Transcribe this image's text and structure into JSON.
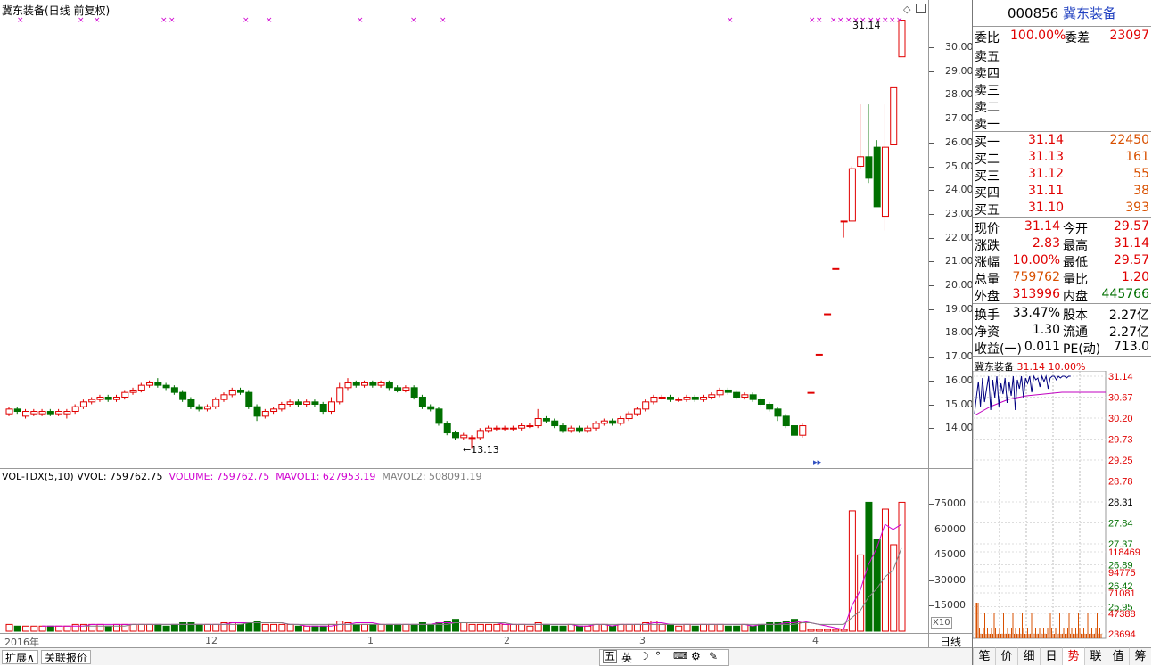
{
  "stock": {
    "code": "000856",
    "name": "冀东装备"
  },
  "main_chart": {
    "title": "冀东装备(日线 前复权)",
    "high_marker": "31.14",
    "low_marker": "←13.13",
    "ticks": [
      "30.00",
      "29.00",
      "28.00",
      "27.00",
      "26.00",
      "25.00",
      "24.00",
      "23.00",
      "22.00",
      "21.00",
      "20.00",
      "19.00",
      "18.00",
      "17.00",
      "16.00",
      "15.00",
      "14.00"
    ],
    "icons": [
      "diamond-icon",
      "square-icon"
    ]
  },
  "volume": {
    "indicator": "VOL-TDX(5,10)",
    "vvol_label": "VVOL: 759762.75",
    "volume_label": "VOLUME: 759762.75",
    "mavol1_label": "MAVOL1: 627953.19",
    "mavol2_label": "MAVOL2: 508091.19",
    "ticks": [
      "75000",
      "60000",
      "45000",
      "30000",
      "15000"
    ],
    "unit": "X10"
  },
  "date_axis": {
    "labels": [
      "2016年",
      "12",
      "1",
      "2",
      "3",
      "4"
    ],
    "period": "日线"
  },
  "bottom_bar": {
    "expand": "扩展∧",
    "related": "关联报价",
    "ime": [
      "五",
      "英"
    ]
  },
  "quote": {
    "weibi_label": "委比",
    "weibi": "100.00%",
    "weicha_label": "委差",
    "weicha": "23097",
    "sell": [
      {
        "label": "卖五"
      },
      {
        "label": "卖四"
      },
      {
        "label": "卖三"
      },
      {
        "label": "卖二"
      },
      {
        "label": "卖一"
      }
    ],
    "buy": [
      {
        "label": "买一",
        "price": "31.14",
        "vol": "22450"
      },
      {
        "label": "买二",
        "price": "31.13",
        "vol": "161"
      },
      {
        "label": "买三",
        "price": "31.12",
        "vol": "55"
      },
      {
        "label": "买四",
        "price": "31.11",
        "vol": "38"
      },
      {
        "label": "买五",
        "price": "31.10",
        "vol": "393"
      }
    ],
    "stats1": [
      {
        "l1": "现价",
        "v1": "31.14",
        "l2": "今开",
        "v2": "29.57"
      },
      {
        "l1": "涨跌",
        "v1": "2.83",
        "l2": "最高",
        "v2": "31.14"
      },
      {
        "l1": "涨幅",
        "v1": "10.00%",
        "l2": "最低",
        "v2": "29.57"
      },
      {
        "l1": "总量",
        "v1": "759762",
        "l2": "量比",
        "v2": "1.20"
      },
      {
        "l1": "外盘",
        "v1": "313996",
        "l2": "内盘",
        "v2": "445766"
      }
    ],
    "stats2": [
      {
        "l1": "换手",
        "v1": "33.47%",
        "l2": "股本",
        "v2": "2.27亿"
      },
      {
        "l1": "净资",
        "v1": "1.30",
        "l2": "流通",
        "v2": "2.27亿"
      },
      {
        "l1": "收益(一)",
        "v1": "0.011",
        "l2": "PE(动)",
        "v2": "713.0"
      }
    ]
  },
  "mini": {
    "name": "冀东装备",
    "price": "31.14",
    "pct": "10.00%",
    "price_ticks": [
      "31.14",
      "30.67",
      "30.20",
      "29.73",
      "29.25",
      "28.78",
      "28.31",
      "27.84",
      "27.37",
      "26.89",
      "26.42",
      "25.95"
    ],
    "vol_ticks": [
      "118469",
      "94775",
      "71081",
      "47388",
      "23694"
    ]
  },
  "tabs": [
    "笔",
    "价",
    "细",
    "日",
    "势",
    "联",
    "值",
    "筹"
  ],
  "colors": {
    "up": "#e00000",
    "down": "#007000",
    "ma1": "#d000d0",
    "ma2": "#808080",
    "marker": "#d000d0"
  },
  "chart_data": {
    "type": "candlestick",
    "ylim": [
      13.0,
      31.5
    ],
    "candles": [
      [
        14.6,
        14.8,
        14.9,
        14.5
      ],
      [
        14.8,
        14.7,
        14.9,
        14.6
      ],
      [
        14.5,
        14.7,
        14.8,
        14.4
      ],
      [
        14.6,
        14.7,
        14.8,
        14.5
      ],
      [
        14.6,
        14.7,
        14.8,
        14.5
      ],
      [
        14.7,
        14.6,
        14.8,
        14.5
      ],
      [
        14.6,
        14.7,
        14.8,
        14.5
      ],
      [
        14.6,
        14.7,
        14.8,
        14.4
      ],
      [
        14.7,
        14.9,
        15.0,
        14.6
      ],
      [
        14.9,
        15.1,
        15.2,
        14.8
      ],
      [
        15.1,
        15.2,
        15.3,
        15.0
      ],
      [
        15.2,
        15.3,
        15.4,
        15.1
      ],
      [
        15.3,
        15.2,
        15.4,
        15.1
      ],
      [
        15.2,
        15.3,
        15.4,
        15.1
      ],
      [
        15.3,
        15.5,
        15.6,
        15.2
      ],
      [
        15.5,
        15.6,
        15.7,
        15.4
      ],
      [
        15.6,
        15.8,
        15.9,
        15.5
      ],
      [
        15.8,
        15.9,
        16.0,
        15.7
      ],
      [
        15.9,
        15.8,
        16.1,
        15.7
      ],
      [
        15.8,
        15.7,
        15.9,
        15.6
      ],
      [
        15.7,
        15.5,
        15.8,
        15.4
      ],
      [
        15.5,
        15.2,
        15.6,
        15.1
      ],
      [
        15.2,
        14.9,
        15.3,
        14.8
      ],
      [
        14.9,
        14.8,
        15.0,
        14.7
      ],
      [
        14.8,
        14.9,
        15.0,
        14.7
      ],
      [
        14.9,
        15.2,
        15.3,
        14.8
      ],
      [
        15.2,
        15.4,
        15.5,
        15.1
      ],
      [
        15.4,
        15.6,
        15.7,
        15.3
      ],
      [
        15.6,
        15.5,
        15.7,
        15.4
      ],
      [
        15.5,
        14.9,
        15.6,
        14.8
      ],
      [
        14.9,
        14.5,
        15.0,
        14.3
      ],
      [
        14.5,
        14.7,
        14.8,
        14.4
      ],
      [
        14.7,
        14.8,
        14.9,
        14.6
      ],
      [
        14.8,
        15.0,
        15.1,
        14.7
      ],
      [
        15.0,
        15.1,
        15.2,
        14.9
      ],
      [
        15.1,
        15.0,
        15.2,
        14.9
      ],
      [
        15.0,
        15.1,
        15.2,
        14.9
      ],
      [
        15.1,
        15.0,
        15.2,
        14.9
      ],
      [
        15.0,
        14.7,
        15.1,
        14.6
      ],
      [
        14.7,
        15.1,
        15.3,
        14.6
      ],
      [
        15.1,
        15.7,
        15.9,
        15.0
      ],
      [
        15.7,
        15.9,
        16.1,
        15.6
      ],
      [
        15.9,
        15.8,
        16.0,
        15.7
      ],
      [
        15.8,
        15.9,
        16.0,
        15.7
      ],
      [
        15.9,
        15.8,
        16.0,
        15.7
      ],
      [
        15.8,
        15.9,
        16.0,
        15.7
      ],
      [
        15.9,
        15.7,
        16.0,
        15.6
      ],
      [
        15.7,
        15.6,
        15.8,
        15.5
      ],
      [
        15.6,
        15.7,
        15.8,
        15.5
      ],
      [
        15.7,
        15.3,
        15.8,
        15.2
      ],
      [
        15.3,
        14.9,
        15.4,
        14.8
      ],
      [
        14.9,
        14.8,
        15.0,
        14.7
      ],
      [
        14.8,
        14.2,
        14.9,
        14.1
      ],
      [
        14.2,
        13.8,
        14.3,
        13.7
      ],
      [
        13.8,
        13.6,
        13.9,
        13.5
      ],
      [
        13.6,
        13.7,
        13.8,
        13.5
      ],
      [
        13.6,
        13.6,
        13.7,
        13.13
      ],
      [
        13.6,
        13.9,
        14.0,
        13.5
      ],
      [
        13.9,
        14.0,
        14.1,
        13.8
      ],
      [
        14.0,
        14.0,
        14.1,
        13.9
      ],
      [
        14.0,
        14.0,
        14.1,
        13.9
      ],
      [
        14.0,
        14.0,
        14.1,
        13.9
      ],
      [
        14.0,
        14.1,
        14.2,
        13.9
      ],
      [
        14.1,
        14.1,
        14.2,
        14.0
      ],
      [
        14.1,
        14.4,
        14.8,
        14.0
      ],
      [
        14.4,
        14.3,
        14.5,
        14.2
      ],
      [
        14.3,
        14.1,
        14.4,
        14.0
      ],
      [
        14.1,
        13.9,
        14.2,
        13.8
      ],
      [
        13.9,
        14.0,
        14.1,
        13.8
      ],
      [
        14.0,
        13.9,
        14.1,
        13.8
      ],
      [
        13.9,
        14.0,
        14.1,
        13.8
      ],
      [
        14.0,
        14.2,
        14.3,
        13.9
      ],
      [
        14.2,
        14.3,
        14.4,
        14.1
      ],
      [
        14.3,
        14.2,
        14.4,
        14.1
      ],
      [
        14.2,
        14.4,
        14.5,
        14.1
      ],
      [
        14.4,
        14.6,
        14.7,
        14.3
      ],
      [
        14.6,
        14.8,
        14.9,
        14.5
      ],
      [
        14.8,
        15.1,
        15.2,
        14.7
      ],
      [
        15.1,
        15.3,
        15.4,
        15.0
      ],
      [
        15.3,
        15.3,
        15.4,
        15.2
      ],
      [
        15.3,
        15.2,
        15.4,
        15.1
      ],
      [
        15.2,
        15.2,
        15.3,
        15.1
      ],
      [
        15.2,
        15.3,
        15.4,
        15.1
      ],
      [
        15.3,
        15.2,
        15.4,
        15.1
      ],
      [
        15.2,
        15.3,
        15.4,
        15.1
      ],
      [
        15.3,
        15.4,
        15.5,
        15.2
      ],
      [
        15.4,
        15.6,
        15.7,
        15.3
      ],
      [
        15.6,
        15.5,
        15.7,
        15.4
      ],
      [
        15.5,
        15.3,
        15.6,
        15.2
      ],
      [
        15.3,
        15.4,
        15.5,
        15.2
      ],
      [
        15.4,
        15.2,
        15.5,
        15.1
      ],
      [
        15.2,
        15.0,
        15.3,
        14.9
      ],
      [
        15.0,
        14.8,
        15.1,
        14.7
      ],
      [
        14.8,
        14.5,
        14.9,
        14.3
      ],
      [
        14.5,
        14.1,
        14.6,
        14.0
      ],
      [
        14.1,
        13.7,
        14.2,
        13.6
      ],
      [
        13.7,
        14.1,
        14.2,
        13.6
      ],
      [
        15.5,
        15.5,
        15.5,
        15.5
      ],
      [
        17.1,
        17.1,
        17.1,
        17.1
      ],
      [
        18.8,
        18.8,
        18.8,
        18.8
      ],
      [
        20.7,
        20.7,
        20.7,
        20.7
      ],
      [
        22.7,
        22.7,
        22.7,
        22.0
      ],
      [
        22.7,
        24.9,
        25.0,
        22.7
      ],
      [
        25.0,
        25.4,
        27.6,
        24.9
      ],
      [
        25.4,
        24.5,
        27.6,
        24.3
      ],
      [
        25.8,
        23.3,
        26.1,
        23.3
      ],
      [
        22.9,
        25.8,
        27.6,
        22.3
      ],
      [
        25.9,
        28.3,
        28.3,
        25.9
      ],
      [
        29.6,
        31.14,
        31.14,
        29.6
      ]
    ],
    "volume": [
      4,
      3,
      3,
      3,
      3,
      3,
      3,
      3,
      4,
      4,
      4,
      4,
      3,
      4,
      4,
      4,
      4,
      4,
      4,
      3,
      4,
      5,
      5,
      4,
      4,
      4,
      5,
      5,
      4,
      5,
      6,
      4,
      4,
      4,
      4,
      3,
      3,
      3,
      3,
      4,
      6,
      5,
      4,
      4,
      4,
      4,
      4,
      4,
      4,
      4,
      5,
      4,
      5,
      6,
      7,
      5,
      4,
      4,
      4,
      4,
      4,
      4,
      4,
      3,
      5,
      4,
      3,
      3,
      4,
      3,
      3,
      4,
      4,
      3,
      4,
      4,
      4,
      5,
      6,
      4,
      4,
      3,
      4,
      3,
      4,
      4,
      4,
      3,
      3,
      4,
      3,
      4,
      5,
      5,
      6,
      7,
      5,
      1,
      1,
      1,
      1,
      1,
      71,
      45,
      76,
      54,
      72,
      51,
      76
    ],
    "mavol1": [
      null,
      null,
      null,
      null,
      3,
      3,
      3,
      3,
      3,
      3,
      4,
      4,
      4,
      4,
      4,
      4,
      4,
      4,
      4,
      4,
      4,
      4,
      4,
      4,
      4,
      4,
      4,
      5,
      5,
      5,
      5,
      5,
      5,
      5,
      4,
      4,
      3,
      3,
      3,
      3,
      4,
      4,
      5,
      5,
      5,
      4,
      4,
      4,
      4,
      4,
      4,
      4,
      5,
      5,
      5,
      5,
      5,
      5,
      5,
      5,
      4,
      4,
      4,
      4,
      4,
      4,
      4,
      4,
      4,
      3,
      3,
      4,
      4,
      3,
      4,
      4,
      4,
      4,
      5,
      5,
      4,
      4,
      4,
      4,
      4,
      4,
      4,
      4,
      4,
      4,
      3,
      4,
      4,
      4,
      5,
      5,
      6,
      5,
      4,
      3,
      2,
      1,
      15,
      24,
      39,
      49,
      63,
      60,
      63
    ],
    "mavol2": [
      null,
      null,
      null,
      null,
      null,
      null,
      null,
      null,
      null,
      3,
      3,
      3,
      3,
      3,
      3,
      4,
      4,
      4,
      4,
      4,
      4,
      4,
      4,
      4,
      4,
      4,
      4,
      4,
      4,
      5,
      5,
      5,
      5,
      5,
      4,
      4,
      4,
      4,
      4,
      4,
      4,
      4,
      4,
      4,
      4,
      4,
      4,
      4,
      4,
      4,
      4,
      4,
      4,
      4,
      5,
      5,
      5,
      5,
      5,
      5,
      5,
      4,
      4,
      4,
      4,
      4,
      4,
      4,
      4,
      4,
      4,
      4,
      4,
      4,
      4,
      4,
      4,
      4,
      4,
      4,
      4,
      4,
      4,
      4,
      4,
      4,
      4,
      4,
      4,
      4,
      4,
      4,
      4,
      4,
      4,
      4,
      5,
      5,
      4,
      4,
      4,
      4,
      8,
      12,
      20,
      25,
      32,
      36,
      49
    ],
    "vol_ylim": [
      0,
      82000
    ],
    "vol_scale": 1000
  }
}
